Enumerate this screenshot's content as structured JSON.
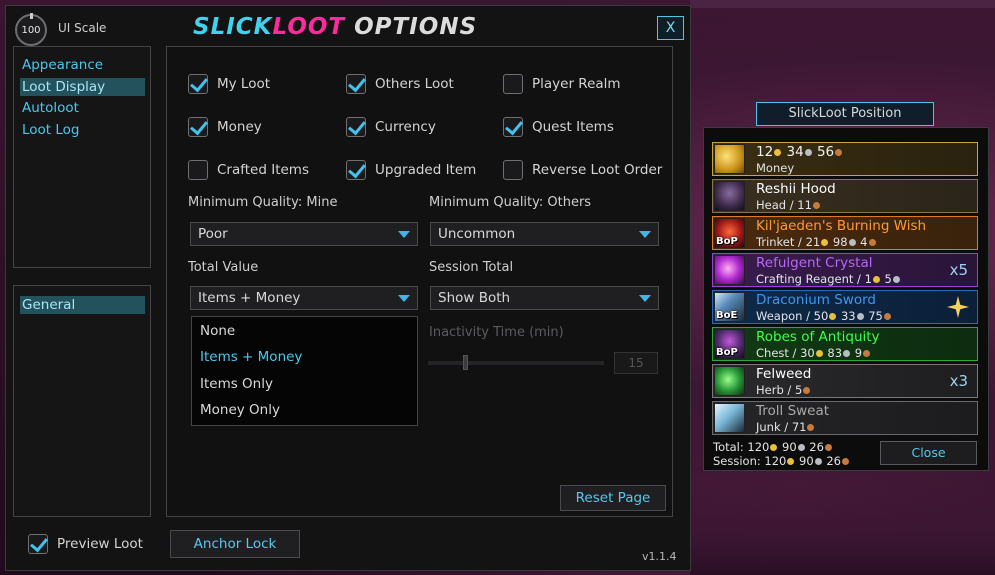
{
  "colors": {
    "accent": "#48c8ee",
    "title_blue": "#3fd4ee",
    "title_pink": "#ff2a9c",
    "poor": "#9d9d9d",
    "common": "#ffffff",
    "uncommon": "#1eff00",
    "rare": "#0070dd",
    "epic": "#a335ee",
    "legendary": "#ff8000"
  },
  "header": {
    "ui_scale_value": "100",
    "ui_scale_label": "UI Scale",
    "title_part1": "SLICK",
    "title_part2": "LOOT",
    "title_part3": " OPTIONS",
    "close_label": "X"
  },
  "sidebar": {
    "items": [
      {
        "label": "Appearance",
        "active": false
      },
      {
        "label": "Loot Display",
        "active": true
      },
      {
        "label": "Autoloot",
        "active": false
      },
      {
        "label": "Loot Log",
        "active": false
      }
    ],
    "profile_items": [
      {
        "label": "General",
        "active": true
      }
    ]
  },
  "options": {
    "checkboxes": [
      {
        "label": "My Loot",
        "checked": true
      },
      {
        "label": "Others Loot",
        "checked": true
      },
      {
        "label": "Player Realm",
        "checked": false
      },
      {
        "label": "Money",
        "checked": true
      },
      {
        "label": "Currency",
        "checked": true
      },
      {
        "label": "Quest Items",
        "checked": true
      },
      {
        "label": "Crafted Items",
        "checked": false
      },
      {
        "label": "Upgraded Item",
        "checked": true
      },
      {
        "label": "Reverse Loot Order",
        "checked": false
      }
    ],
    "min_quality_mine_label": "Minimum Quality: Mine",
    "min_quality_mine_value": "Poor",
    "min_quality_others_label": "Minimum Quality: Others",
    "min_quality_others_value": "Uncommon",
    "total_value_label": "Total Value",
    "total_value_value": "Items + Money",
    "session_total_label": "Session Total",
    "session_total_value": "Show Both",
    "total_value_options": [
      "None",
      "Items + Money",
      "Items Only",
      "Money Only"
    ],
    "total_value_selected_index": 1,
    "inactivity_label": "Inactivity Time (min)",
    "inactivity_value": "15",
    "reset_label": "Reset Page"
  },
  "footer": {
    "preview_label": "Preview Loot",
    "preview_checked": true,
    "anchor_lock_label": "Anchor Lock",
    "version": "v1.1.4"
  },
  "loot": {
    "position_button": "SlickLoot Position",
    "close_label": "Close",
    "rows": [
      {
        "icon": "gold-coins-icon",
        "name": "",
        "g": "12",
        "s": "34",
        "c": "56",
        "sub": "Money",
        "quality": "money",
        "bind": "",
        "count": ""
      },
      {
        "icon": "hood-icon",
        "name": "Reshii Hood",
        "sub_type": "Head",
        "ilvl": "11",
        "quality": "common",
        "bind": "",
        "count": ""
      },
      {
        "icon": "trinket-icon",
        "name": "Kil'jaeden's Burning Wish",
        "sub_type": "Trinket",
        "g": "21",
        "s": "98",
        "c": "4",
        "quality": "legendary",
        "bind": "BoP",
        "count": ""
      },
      {
        "icon": "crystal-icon",
        "name": "Refulgent Crystal",
        "sub_type": "Crafting Reagent",
        "g": "1",
        "s": "5",
        "c": "",
        "quality": "epic",
        "bind": "",
        "count": "x5"
      },
      {
        "icon": "sword-icon",
        "name": "Draconium Sword",
        "sub_type": "Weapon",
        "g": "50",
        "s": "33",
        "c": "75",
        "quality": "rare",
        "bind": "BoE",
        "count": ""
      },
      {
        "icon": "robe-icon",
        "name": "Robes of Antiquity",
        "sub_type": "Chest",
        "g": "30",
        "s": "83",
        "c": "9",
        "quality": "uncommon",
        "bind": "BoP",
        "count": ""
      },
      {
        "icon": "herb-icon",
        "name": "Felweed",
        "sub_type": "Herb",
        "g": "",
        "s": "",
        "c": "5",
        "quality": "common",
        "bind": "",
        "count": "x3"
      },
      {
        "icon": "vial-icon",
        "name": "Troll Sweat",
        "sub_type": "Junk",
        "g": "",
        "s": "",
        "c": "71",
        "quality": "poor",
        "bind": "",
        "count": ""
      }
    ],
    "total_label": "Total:",
    "total_g": "120",
    "total_s": "90",
    "total_c": "26",
    "session_label": "Session:",
    "session_g": "120",
    "session_s": "90",
    "session_c": "26"
  }
}
